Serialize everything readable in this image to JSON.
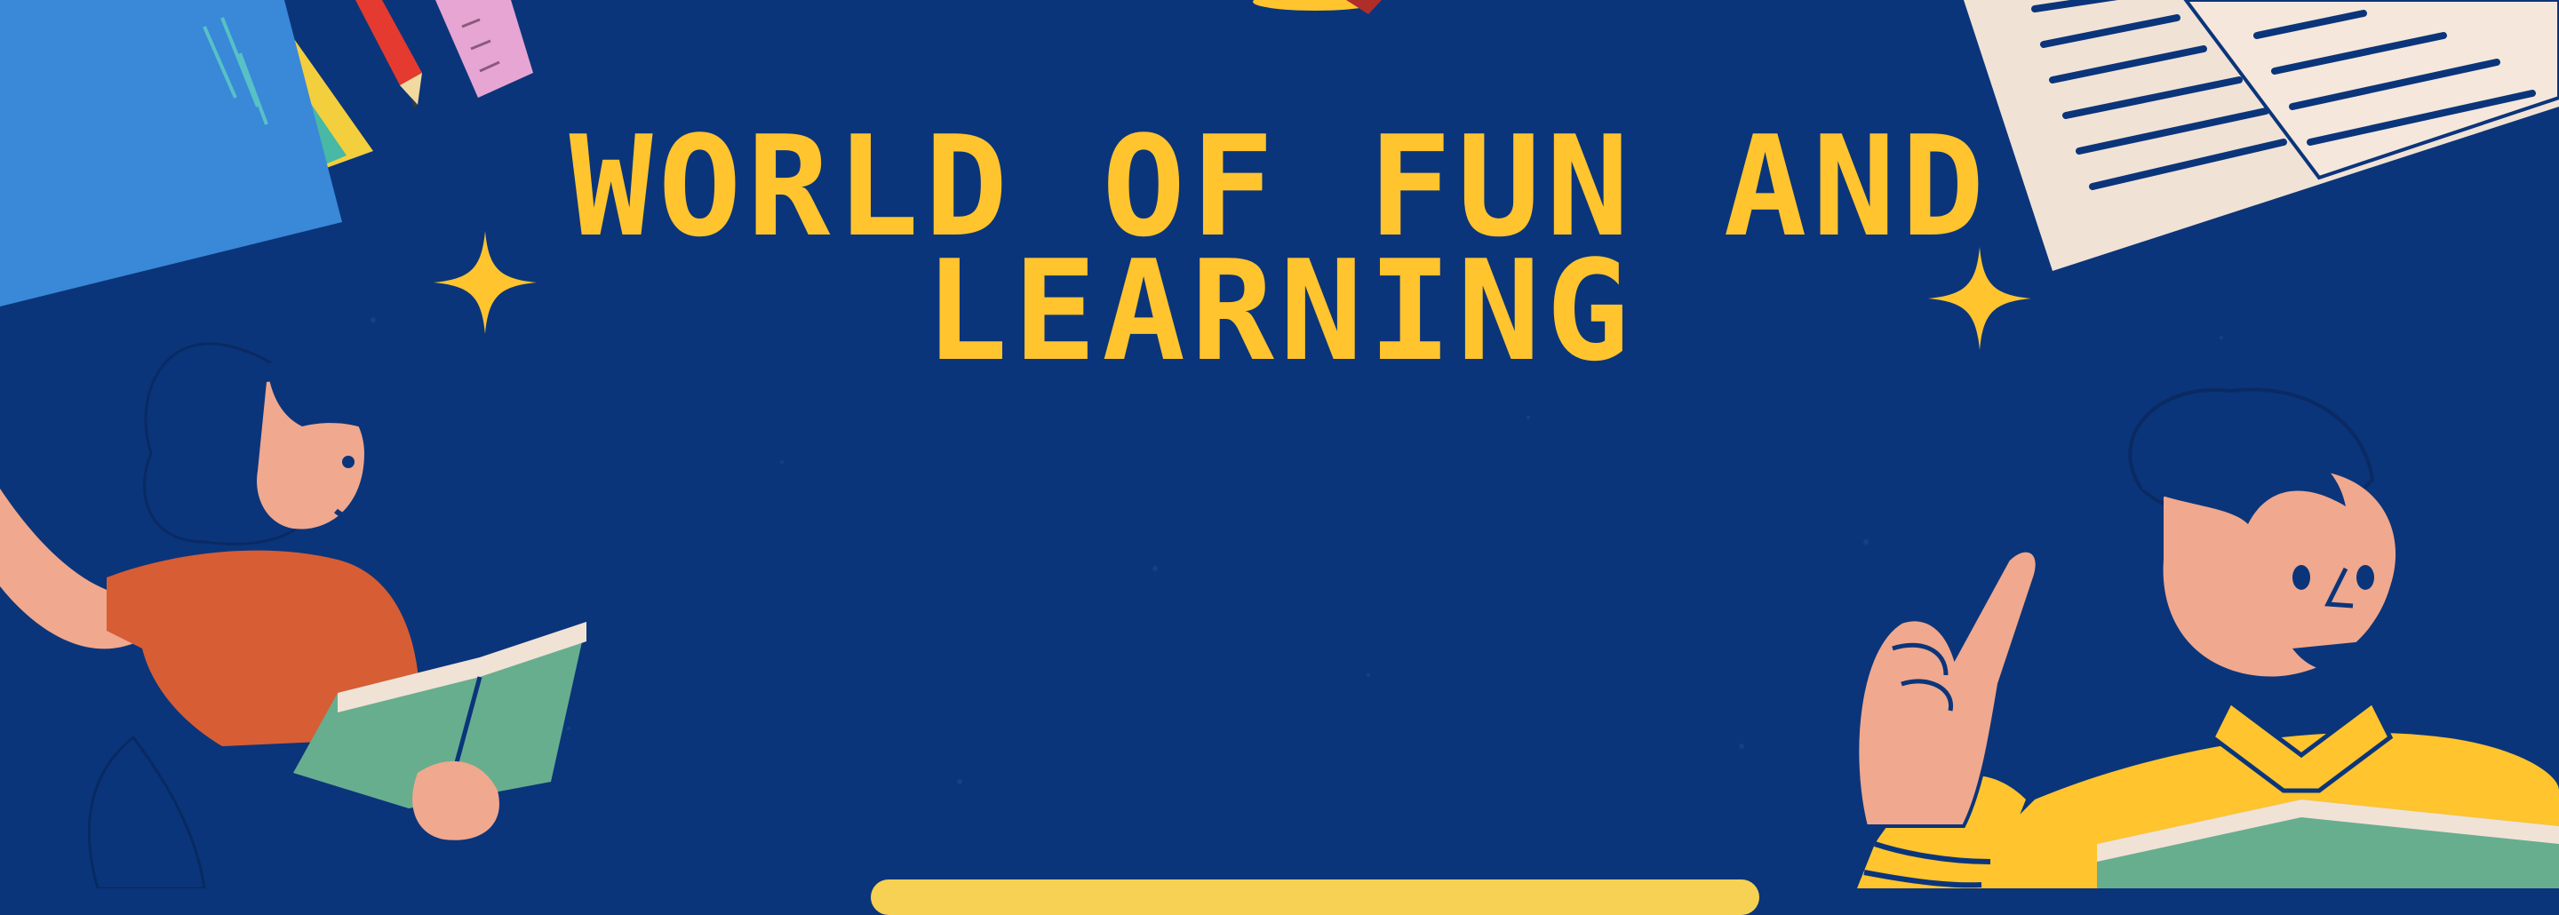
{
  "banner": {
    "title_line_1": "WORLD OF FUN AND",
    "title_line_2": "LEARNING"
  },
  "colors": {
    "background": "#0b357a",
    "title": "#ffc42e",
    "accent_orange": "#d75d35",
    "accent_green": "#67ae8f",
    "skin": "#efa68d"
  },
  "icons": [
    "blue-folder-icon",
    "pencil-icon",
    "ruler-icon",
    "open-document-icon",
    "sparkle-icon",
    "girl-reading-illustration",
    "boy-pointing-illustration"
  ]
}
